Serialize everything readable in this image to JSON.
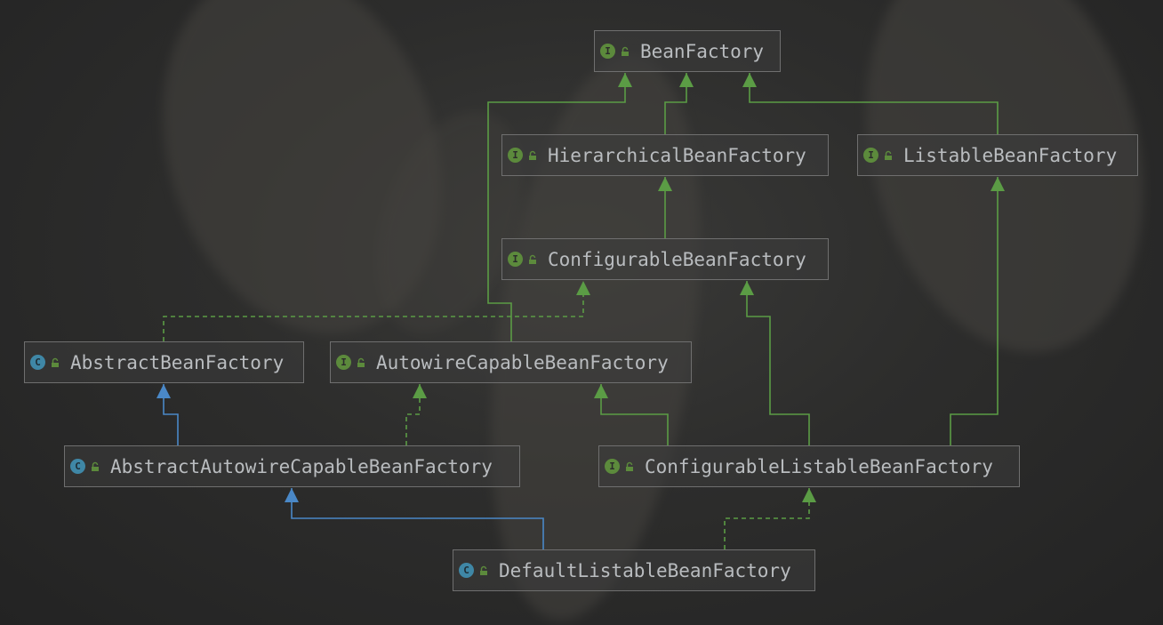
{
  "colors": {
    "implements_edge": "#5b9c45",
    "extends_edge": "#4a88c7",
    "interface_badge": "#5c8a3c",
    "class_badge": "#3f87a6",
    "node_border": "#6f6f6f",
    "label_text": "#b9bcbf"
  },
  "nodes": [
    {
      "id": "BeanFactory",
      "label": "BeanFactory",
      "kind": "interface",
      "badge": "I",
      "icon": "lock-open-icon"
    },
    {
      "id": "HierarchicalBeanFactory",
      "label": "HierarchicalBeanFactory",
      "kind": "interface",
      "badge": "I",
      "icon": "lock-open-icon"
    },
    {
      "id": "ListableBeanFactory",
      "label": "ListableBeanFactory",
      "kind": "interface",
      "badge": "I",
      "icon": "lock-open-icon"
    },
    {
      "id": "ConfigurableBeanFactory",
      "label": "ConfigurableBeanFactory",
      "kind": "interface",
      "badge": "I",
      "icon": "lock-open-icon"
    },
    {
      "id": "AbstractBeanFactory",
      "label": "AbstractBeanFactory",
      "kind": "abstract-class",
      "badge": "C",
      "icon": "lock-open-icon"
    },
    {
      "id": "AutowireCapableBeanFactory",
      "label": "AutowireCapableBeanFactory",
      "kind": "interface",
      "badge": "I",
      "icon": "lock-open-icon"
    },
    {
      "id": "AbstractAutowireCapableBeanFactory",
      "label": "AbstractAutowireCapableBeanFactory",
      "kind": "abstract-class",
      "badge": "C",
      "icon": "lock-open-icon"
    },
    {
      "id": "ConfigurableListableBeanFactory",
      "label": "ConfigurableListableBeanFactory",
      "kind": "interface",
      "badge": "I",
      "icon": "lock-open-icon"
    },
    {
      "id": "DefaultListableBeanFactory",
      "label": "DefaultListableBeanFactory",
      "kind": "class",
      "badge": "C",
      "icon": "lock-open-icon"
    }
  ],
  "edges": [
    {
      "from": "HierarchicalBeanFactory",
      "to": "BeanFactory",
      "type": "extends-interface"
    },
    {
      "from": "ListableBeanFactory",
      "to": "BeanFactory",
      "type": "extends-interface"
    },
    {
      "from": "AutowireCapableBeanFactory",
      "to": "BeanFactory",
      "type": "extends-interface"
    },
    {
      "from": "ConfigurableBeanFactory",
      "to": "HierarchicalBeanFactory",
      "type": "extends-interface"
    },
    {
      "from": "AbstractBeanFactory",
      "to": "ConfigurableBeanFactory",
      "type": "implements"
    },
    {
      "from": "AbstractAutowireCapableBeanFactory",
      "to": "AbstractBeanFactory",
      "type": "extends-class"
    },
    {
      "from": "AbstractAutowireCapableBeanFactory",
      "to": "AutowireCapableBeanFactory",
      "type": "implements"
    },
    {
      "from": "ConfigurableListableBeanFactory",
      "to": "AutowireCapableBeanFactory",
      "type": "extends-interface"
    },
    {
      "from": "ConfigurableListableBeanFactory",
      "to": "ConfigurableBeanFactory",
      "type": "extends-interface"
    },
    {
      "from": "ConfigurableListableBeanFactory",
      "to": "ListableBeanFactory",
      "type": "extends-interface"
    },
    {
      "from": "DefaultListableBeanFactory",
      "to": "AbstractAutowireCapableBeanFactory",
      "type": "extends-class"
    },
    {
      "from": "DefaultListableBeanFactory",
      "to": "ConfigurableListableBeanFactory",
      "type": "implements"
    }
  ]
}
